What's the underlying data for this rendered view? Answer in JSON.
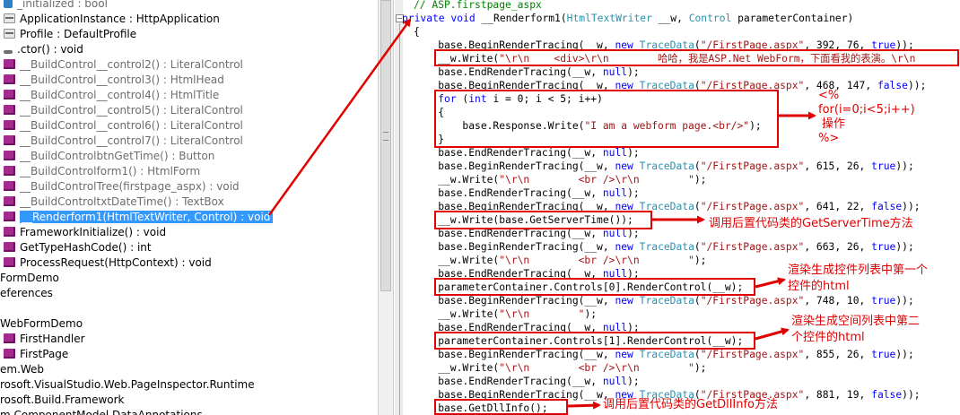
{
  "tree": {
    "items": [
      {
        "icon": "field",
        "label": "_initialized : bool",
        "gray": true
      },
      {
        "icon": "property",
        "label": "ApplicationInstance : HttpApplication",
        "gray": false
      },
      {
        "icon": "property",
        "label": "Profile : DefaultProfile",
        "gray": false
      },
      {
        "icon": "constructor",
        "label": ".ctor() : void",
        "gray": false
      },
      {
        "icon": "method",
        "label": "__BuildControl__control2() : LiteralControl",
        "gray": true
      },
      {
        "icon": "method",
        "label": "__BuildControl__control3() : HtmlHead",
        "gray": true
      },
      {
        "icon": "method",
        "label": "__BuildControl__control4() : HtmlTitle",
        "gray": true
      },
      {
        "icon": "method",
        "label": "__BuildControl__control5() : LiteralControl",
        "gray": true
      },
      {
        "icon": "method",
        "label": "__BuildControl__control6() : LiteralControl",
        "gray": true
      },
      {
        "icon": "method",
        "label": "__BuildControl__control7() : LiteralControl",
        "gray": true
      },
      {
        "icon": "method",
        "label": "__BuildControlbtnGetTime() : Button",
        "gray": true
      },
      {
        "icon": "method",
        "label": "__BuildControlform1() : HtmlForm",
        "gray": true
      },
      {
        "icon": "method",
        "label": "__BuildControlTree(firstpage_aspx) : void",
        "gray": true
      },
      {
        "icon": "method",
        "label": "__BuildControltxtDateTime() : TextBox",
        "gray": true
      },
      {
        "icon": "method",
        "label": "__Renderform1(HtmlTextWriter, Control) : void",
        "gray": false,
        "selected": true
      },
      {
        "icon": "method",
        "label": "FrameworkInitialize() : void",
        "gray": false
      },
      {
        "icon": "method",
        "label": "GetTypeHashCode() : int",
        "gray": false
      },
      {
        "icon": "method",
        "label": "ProcessRequest(HttpContext) : void",
        "gray": false
      }
    ],
    "lower": [
      {
        "label": "FormDemo"
      },
      {
        "label": "eferences"
      },
      {
        "label": ""
      },
      {
        "label": "WebFormDemo"
      },
      {
        "label": "FirstHandler",
        "icon": "folder"
      },
      {
        "label": "FirstPage",
        "icon": "folder"
      },
      {
        "label": "em.Web"
      },
      {
        "label": "rosoft.VisualStudio.Web.PageInspector.Runtime"
      },
      {
        "label": "rosoft.Build.Framework"
      },
      {
        "label": "m.ComponentModel.DataAnnotations"
      }
    ]
  },
  "code_lines": [
    "// ASP.firstpage_aspx",
    "private void __Renderform1(HtmlTextWriter __w, Control parameterContainer)",
    "{",
    "    base.BeginRenderTracing(__w, new TraceData(\"/FirstPage.aspx\", 392, 76, true));",
    "    __w.Write(\"\\r\\n    <div>\\r\\n        哈哈，我是ASP.Net WebForm，下面看我的表演。\\r\\n",
    "    base.EndRenderTracing(__w, null);",
    "    base.BeginRenderTracing(__w, new TraceData(\"/FirstPage.aspx\", 468, 147, false));",
    "    for (int i = 0; i < 5; i++)",
    "    {",
    "        base.Response.Write(\"I am a webform page.<br/>\");",
    "    }",
    "    base.EndRenderTracing(__w, null);",
    "    base.BeginRenderTracing(__w, new TraceData(\"/FirstPage.aspx\", 615, 26, true));",
    "    __w.Write(\"\\r\\n        <br />\\r\\n        \");",
    "    base.EndRenderTracing(__w, null);",
    "    base.BeginRenderTracing(__w, new TraceData(\"/FirstPage.aspx\", 641, 22, false));",
    "    __w.Write(base.GetServerTime());",
    "    base.EndRenderTracing(__w, null);",
    "    base.BeginRenderTracing(__w, new TraceData(\"/FirstPage.aspx\", 663, 26, true));",
    "    __w.Write(\"\\r\\n        <br />\\r\\n        \");",
    "    base.EndRenderTracing(__w, null);",
    "    parameterContainer.Controls[0].RenderControl(__w);",
    "    base.BeginRenderTracing(__w, new TraceData(\"/FirstPage.aspx\", 748, 10, true));",
    "    __w.Write(\"\\r\\n        \");",
    "    base.EndRenderTracing(__w, null);",
    "    parameterContainer.Controls[1].RenderControl(__w);",
    "    base.BeginRenderTracing(__w, new TraceData(\"/FirstPage.aspx\", 855, 26, true));",
    "    __w.Write(\"\\r\\n        <br />\\r\\n        \");",
    "    base.EndRenderTracing(__w, null);",
    "    base.BeginRenderTracing(__w, new TraceData(\"/FirstPage.aspx\", 881, 19, false));",
    "    base.GetDllInfo();"
  ],
  "annotations": {
    "for_loop": [
      "<%",
      "for(i=0;i<5;i++)",
      "操作",
      "%>"
    ],
    "server_time": "调用后置代码类的GetServerTime方法",
    "control0": [
      "渲染生成控件列表中第一个",
      "控件的html"
    ],
    "control1": [
      "渲染生成空间列表中第二",
      "个控件的html"
    ],
    "dll_info": "调用后置代码类的GetDllInfo方法"
  },
  "colors": {
    "keyword": "#0000ff",
    "string": "#a31515",
    "type": "#2b91af",
    "comment": "#008000",
    "annotation": "#e00000",
    "selection": "#3399ff"
  }
}
